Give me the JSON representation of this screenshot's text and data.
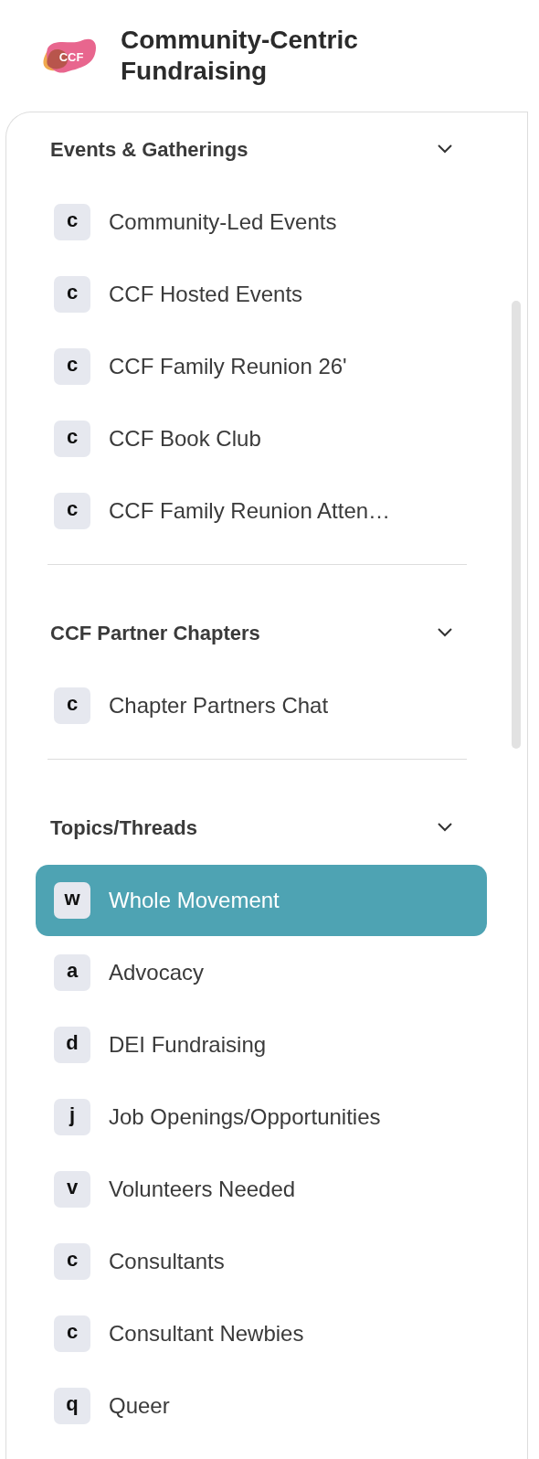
{
  "header": {
    "logo_text": "CCF",
    "title": "Community-Centric Fundraising"
  },
  "sections": [
    {
      "title": "Events & Gatherings",
      "expanded": true,
      "items": [
        {
          "letter": "c",
          "label": "Community-Led Events",
          "selected": false
        },
        {
          "letter": "c",
          "label": "CCF Hosted Events",
          "selected": false
        },
        {
          "letter": "c",
          "label": "CCF Family Reunion 26'",
          "selected": false
        },
        {
          "letter": "c",
          "label": "CCF Book Club",
          "selected": false
        },
        {
          "letter": "c",
          "label": "CCF Family Reunion Atten…",
          "selected": false
        }
      ]
    },
    {
      "title": "CCF Partner Chapters",
      "expanded": true,
      "items": [
        {
          "letter": "c",
          "label": "Chapter Partners Chat",
          "selected": false
        }
      ]
    },
    {
      "title": "Topics/Threads",
      "expanded": true,
      "items": [
        {
          "letter": "w",
          "label": "Whole Movement",
          "selected": true
        },
        {
          "letter": "a",
          "label": "Advocacy",
          "selected": false
        },
        {
          "letter": "d",
          "label": "DEI Fundraising",
          "selected": false
        },
        {
          "letter": "j",
          "label": "Job Openings/Opportunities",
          "selected": false
        },
        {
          "letter": "v",
          "label": "Volunteers Needed",
          "selected": false
        },
        {
          "letter": "c",
          "label": "Consultants",
          "selected": false
        },
        {
          "letter": "c",
          "label": "Consultant Newbies",
          "selected": false
        },
        {
          "letter": "q",
          "label": "Queer",
          "selected": false
        }
      ]
    }
  ]
}
